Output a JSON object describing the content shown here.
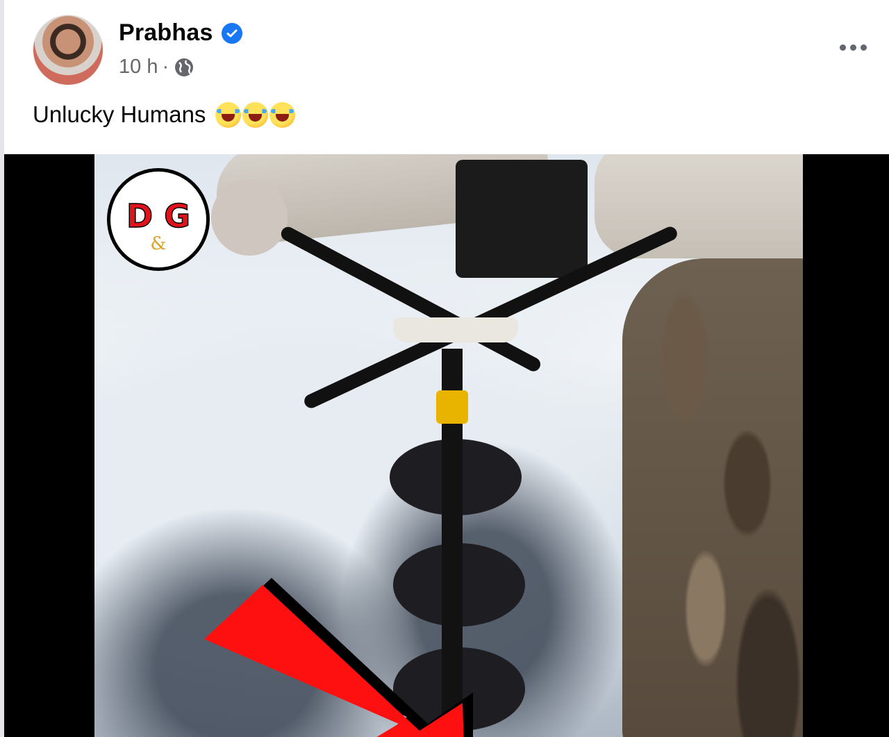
{
  "post": {
    "author": "Prabhas",
    "verified": true,
    "timestamp": "10 h",
    "separator": "·",
    "audience_icon": "globe-icon",
    "more_icon": "more-options-icon",
    "caption": "Unlucky Humans",
    "caption_emojis": [
      "rolling-on-floor-laughing-emoji",
      "rolling-on-floor-laughing-emoji",
      "rolling-on-floor-laughing-emoji"
    ]
  },
  "video": {
    "watermark": {
      "letters_top": "D G",
      "letter_mid": "&",
      "colors": {
        "letters": "#e0121b",
        "ampersand": "#d9a42c",
        "ring": "#000000"
      }
    },
    "arrow_color": "#ff1010"
  },
  "colors": {
    "name": "#050505",
    "meta": "#65676b",
    "verified_badge": "#1877f2",
    "letterbox": "#000000"
  }
}
